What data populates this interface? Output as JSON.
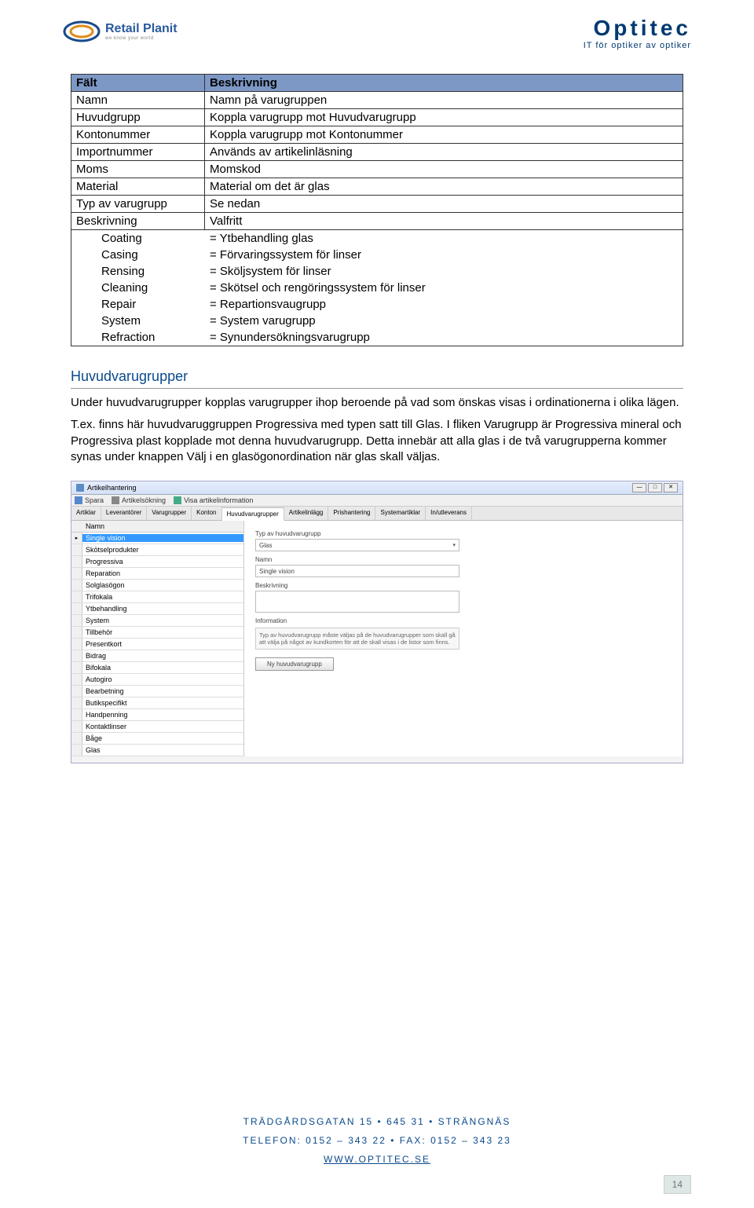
{
  "header": {
    "logo_left_main": "Retail Planit",
    "logo_left_sub": "we know your world",
    "logo_right_company": "Optitec",
    "logo_right_tag": "IT för optiker av optiker"
  },
  "table": {
    "col1": "Fält",
    "col2": "Beskrivning",
    "rows": [
      {
        "f": "Namn",
        "d": "Namn på varugruppen"
      },
      {
        "f": "Huvudgrupp",
        "d": "Koppla varugrupp mot Huvudvarugrupp"
      },
      {
        "f": "Kontonummer",
        "d": "Koppla varugrupp mot Kontonummer"
      },
      {
        "f": "Importnummer",
        "d": "Används av artikelinläsning"
      },
      {
        "f": "Moms",
        "d": "Momskod"
      },
      {
        "f": "Material",
        "d": "Material om det är glas"
      },
      {
        "f": "Typ av varugrupp",
        "d": "Se nedan"
      },
      {
        "f": "Beskrivning",
        "d": "Valfritt"
      }
    ],
    "nested": [
      {
        "f": "Coating",
        "d": "= Ytbehandling glas"
      },
      {
        "f": "Casing",
        "d": "= Förvaringssystem för linser"
      },
      {
        "f": "Rensing",
        "d": "= Sköljsystem för linser"
      },
      {
        "f": "Cleaning",
        "d": "= Skötsel och rengöringssystem för linser"
      },
      {
        "f": "Repair",
        "d": "= Repartionsvaugrupp"
      },
      {
        "f": "System",
        "d": " = System varugrupp"
      },
      {
        "f": "Refraction",
        "d": "= Synundersökningsvarugrupp"
      }
    ]
  },
  "section": {
    "title": "Huvudvarugrupper",
    "p1": "Under huvudvarugrupper kopplas varugrupper ihop beroende på vad som önskas visas i ordinationerna i olika lägen.",
    "p2": "T.ex. finns här huvudvaruggruppen Progressiva med typen satt till Glas. I fliken Varugrupp är Progressiva mineral och Progressiva plast kopplade mot denna huvudvarugrupp. Detta innebär att alla glas i de två varugrupperna kommer synas under knappen Välj i en glasögonordination när glas skall väljas."
  },
  "app": {
    "title": "Artikelhantering",
    "toolbar": {
      "save": "Spara",
      "search": "Artikelsökning",
      "info": "Visa artikelinformation"
    },
    "tabs": [
      "Artiklar",
      "Leverantörer",
      "Varugrupper",
      "Konton",
      "Huvudvarugrupper",
      "Artikelinlägg",
      "Prishantering",
      "Systemartiklar",
      "In/utleverans"
    ],
    "active_tab": 4,
    "list_header": "Namn",
    "items": [
      "Single vision",
      "Skötselprodukter",
      "Progressiva",
      "Reparation",
      "Solglasögon",
      "Trifokala",
      "Ytbehandling",
      "System",
      "Tillbehör",
      "Presentkort",
      "Bidrag",
      "Bifokala",
      "Autogiro",
      "Bearbetning",
      "Butikspecifikt",
      "Handpenning",
      "Kontaktlinser",
      "Båge",
      "Glas"
    ],
    "selected": 0,
    "form": {
      "type_label": "Typ av huvudvarugrupp",
      "type_value": "Glas",
      "name_label": "Namn",
      "name_value": "Single vision",
      "desc_label": "Beskrivning",
      "info_label": "Information",
      "info_text": "Typ av huvudvarugrupp måste väljas på de huvudvarugrupper som skall gå att välja på något av kundkorten för att de skall visas i de listor som finns.",
      "button": "Ny huvudvarugrupp"
    }
  },
  "footer": {
    "addr": "TRÄDGÅRDSGATAN 15 • 645 31 • STRÄNGNÄS",
    "phone": "TELEFON: 0152 – 343 22 • FAX: 0152 – 343 23",
    "url": "WWW.OPTITEC.SE"
  },
  "page_number": "14"
}
